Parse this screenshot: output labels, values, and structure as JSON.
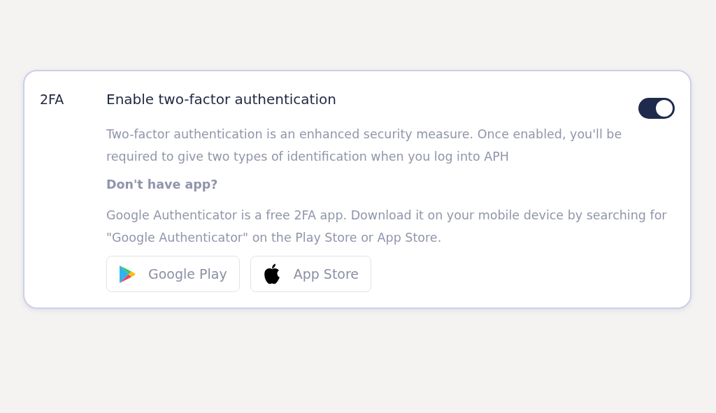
{
  "section": {
    "label": "2FA",
    "title": "Enable two-factor authentication",
    "toggle": {
      "on": true
    },
    "description": "Two-factor authentication is an enhanced security measure. Once enabled, you'll be required to give two types of identification when you log into APH",
    "subheading": "Don't have app?",
    "app_text": "Google Authenticator is a free 2FA app. Download it on your mobile device by searching for \"Google Authenticator\" on the Play Store or App Store.",
    "store_buttons": [
      {
        "kind": "google",
        "label": "Google Play"
      },
      {
        "kind": "apple",
        "label": "App Store"
      }
    ]
  }
}
